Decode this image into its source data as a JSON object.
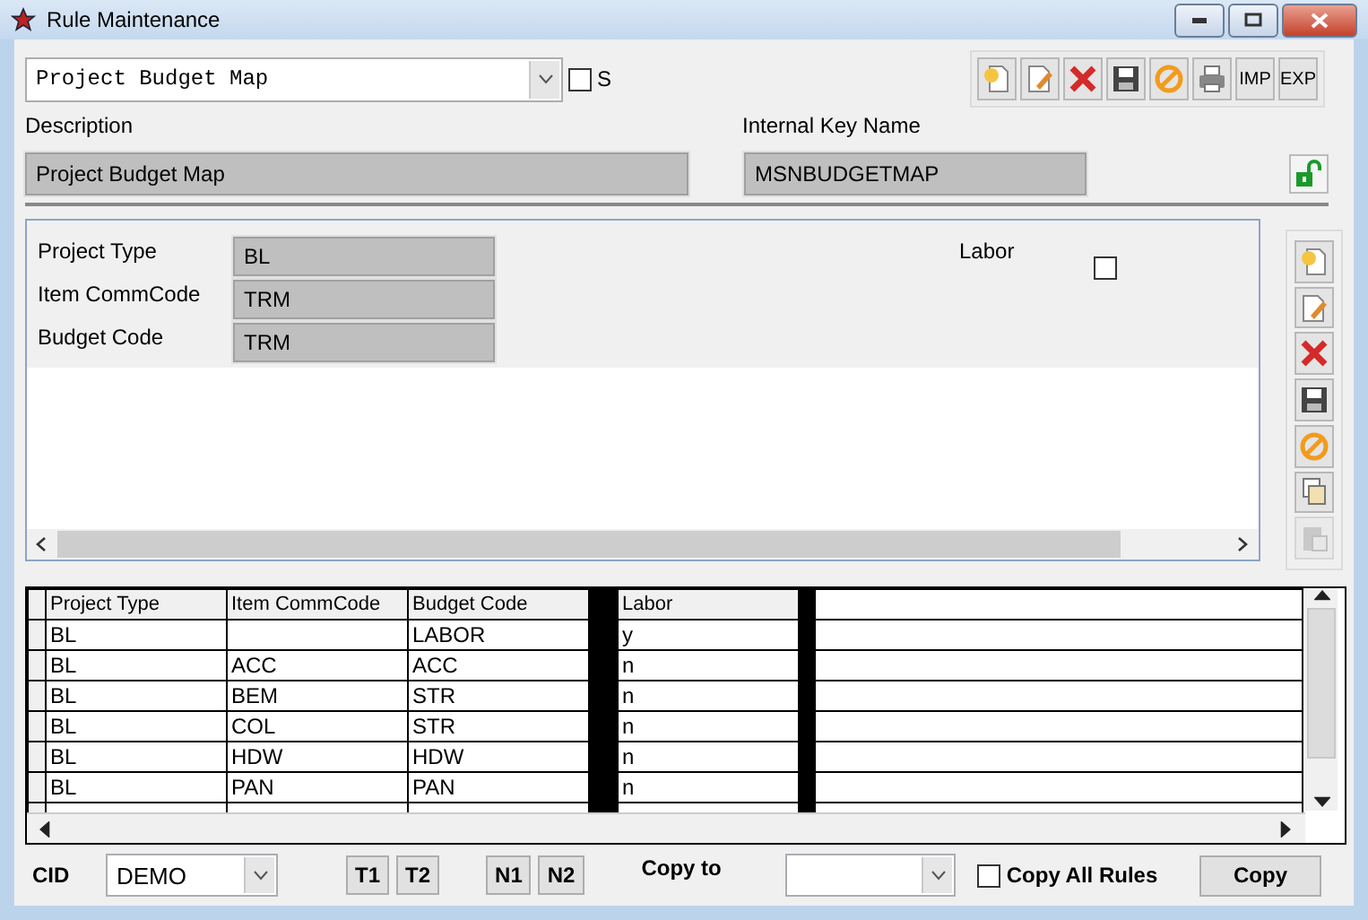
{
  "window": {
    "title": "Rule Maintenance"
  },
  "rule_select": {
    "value": "Project Budget Map"
  },
  "s_checkbox": {
    "label": "S",
    "checked": false
  },
  "toolbar": [
    {
      "kind": "new",
      "disabled": false
    },
    {
      "kind": "edit",
      "disabled": false
    },
    {
      "kind": "delete",
      "disabled": false
    },
    {
      "kind": "save",
      "disabled": false
    },
    {
      "kind": "cancel",
      "disabled": false
    },
    {
      "kind": "print",
      "disabled": false
    },
    {
      "kind": "text",
      "label": "IMP",
      "disabled": false
    },
    {
      "kind": "text",
      "label": "EXP",
      "disabled": false
    }
  ],
  "description": {
    "label": "Description",
    "value": "Project Budget Map"
  },
  "internal_key": {
    "label": "Internal Key Name",
    "value": "MSNBUDGETMAP"
  },
  "detail": {
    "fields": [
      {
        "label": "Project Type",
        "value": "BL"
      },
      {
        "label": "Item CommCode",
        "value": "TRM"
      },
      {
        "label": "Budget Code",
        "value": "TRM"
      }
    ],
    "labor": {
      "label": "Labor",
      "checked": false
    }
  },
  "side_toolbar": [
    {
      "kind": "new",
      "disabled": false
    },
    {
      "kind": "edit",
      "disabled": false
    },
    {
      "kind": "delete",
      "disabled": false
    },
    {
      "kind": "save",
      "disabled": false
    },
    {
      "kind": "cancel",
      "disabled": false
    },
    {
      "kind": "copy",
      "disabled": false
    },
    {
      "kind": "paste",
      "disabled": true
    }
  ],
  "table": {
    "columns": [
      "Project Type",
      "Item CommCode",
      "Budget Code",
      "Labor"
    ],
    "rows": [
      [
        "BL",
        "",
        "LABOR",
        "y"
      ],
      [
        "BL",
        "ACC",
        "ACC",
        "n"
      ],
      [
        "BL",
        "BEM",
        "STR",
        "n"
      ],
      [
        "BL",
        "COL",
        "STR",
        "n"
      ],
      [
        "BL",
        "HDW",
        "HDW",
        "n"
      ],
      [
        "BL",
        "PAN",
        "PAN",
        "n"
      ]
    ]
  },
  "bottom": {
    "cid_label": "CID",
    "cid_value": "DEMO",
    "buttons": [
      "T1",
      "T2",
      "N1",
      "N2"
    ],
    "copy_to_label": "Copy to",
    "copy_all": {
      "label": "Copy All Rules",
      "checked": false
    },
    "copy_button": "Copy"
  }
}
